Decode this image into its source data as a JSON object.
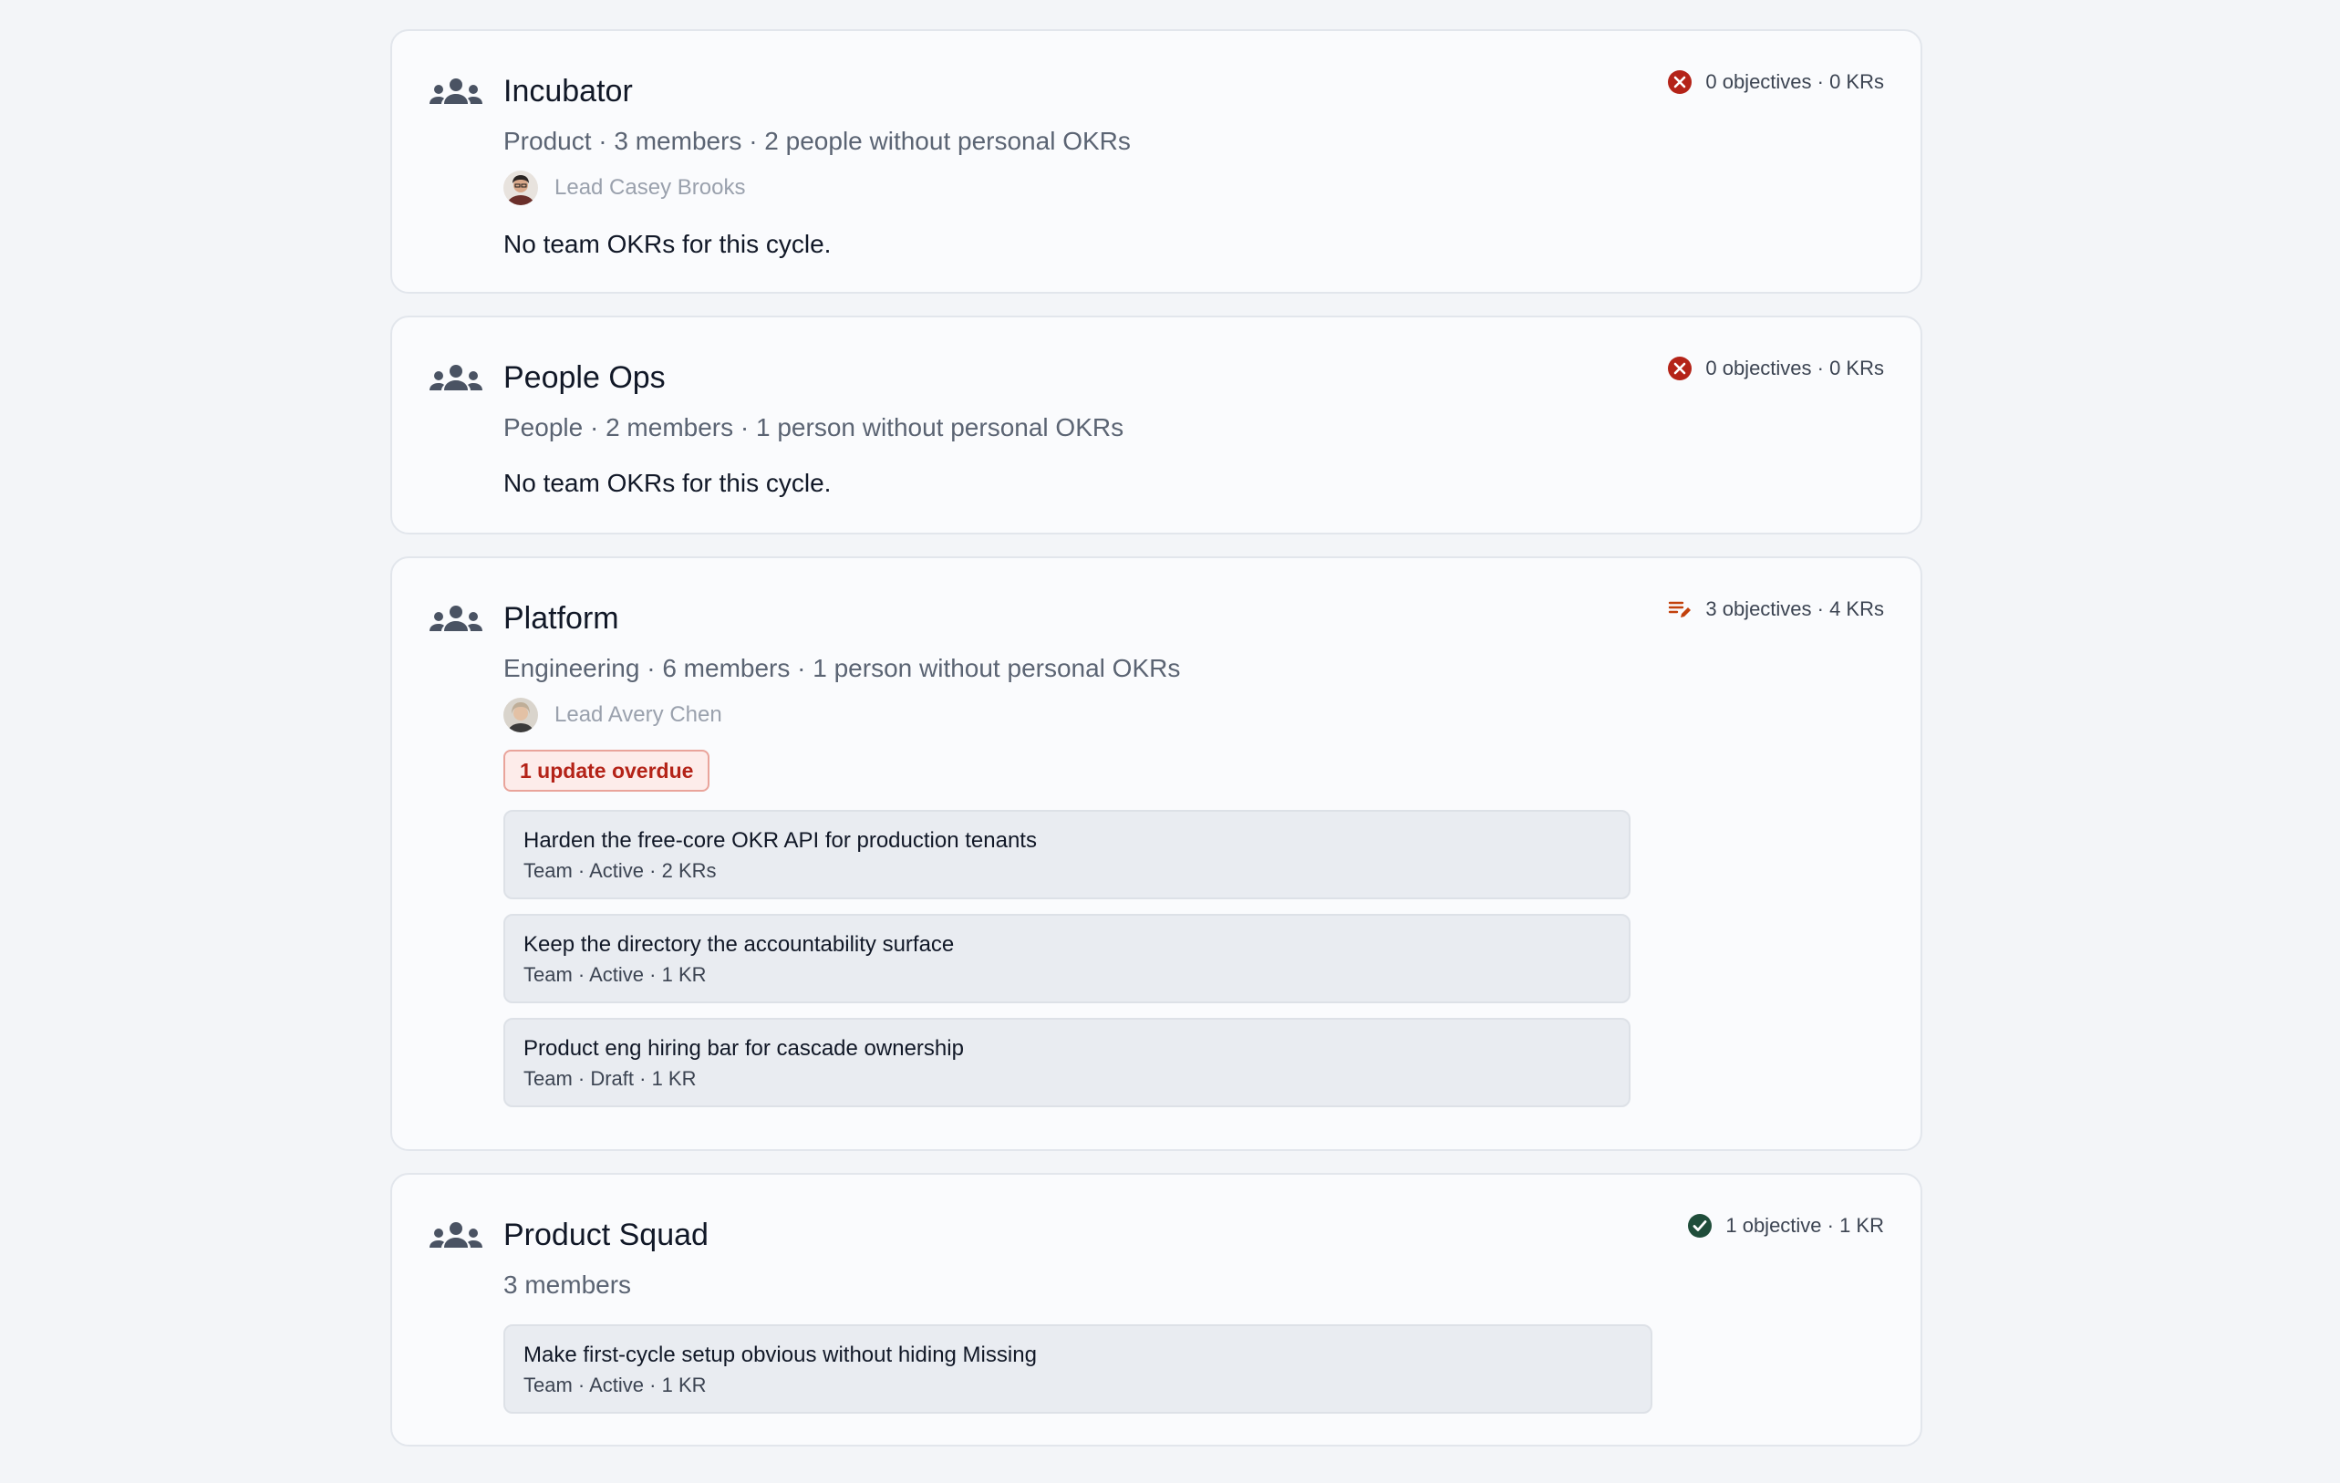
{
  "colors": {
    "error": "#b42318",
    "warning": "#c2410c",
    "success": "#1f4d3a",
    "icon": "#4a5363"
  },
  "teams": [
    {
      "name": "Incubator",
      "meta": "Product · 3 members · 2 people without personal OKRs",
      "lead": "Lead Casey Brooks",
      "summary": "0 objectives · 0 KRs",
      "summary_icon": "error-circle-icon",
      "empty_note": "No team OKRs for this cycle."
    },
    {
      "name": "People Ops",
      "meta": "People · 2 members · 1 person without personal OKRs",
      "summary": "0 objectives · 0 KRs",
      "summary_icon": "error-circle-icon",
      "empty_note": "No team OKRs for this cycle."
    },
    {
      "name": "Platform",
      "meta": "Engineering · 6 members · 1 person without personal OKRs",
      "lead": "Lead Avery Chen",
      "summary": "3 objectives · 4 KRs",
      "summary_icon": "edit-list-icon",
      "badge": "1 update overdue",
      "objectives": [
        {
          "title": "Harden the free-core OKR API for production tenants",
          "meta": "Team · Active · 2 KRs"
        },
        {
          "title": "Keep the directory the accountability surface",
          "meta": "Team · Active · 1 KR"
        },
        {
          "title": "Product eng hiring bar for cascade ownership",
          "meta": "Team · Draft · 1 KR"
        }
      ]
    },
    {
      "name": "Product Squad",
      "meta": "3 members",
      "summary": "1 objective · 1 KR",
      "summary_icon": "check-circle-icon",
      "objectives": [
        {
          "title": "Make first-cycle setup obvious without hiding Missing",
          "meta": "Team · Active · 1 KR"
        }
      ]
    }
  ]
}
